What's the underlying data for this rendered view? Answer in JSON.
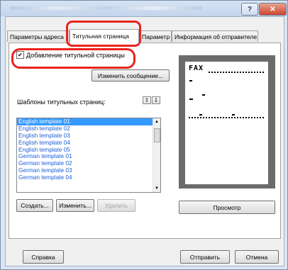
{
  "window": {
    "help_button": "?",
    "close_button": "✕"
  },
  "tabs": [
    {
      "label": "Параметры адреса"
    },
    {
      "label": "Титульная страница"
    },
    {
      "label": "Параметр"
    },
    {
      "label": "Информация об отправителе"
    }
  ],
  "cover_page": {
    "checkbox_label": "Добавление титульной страницы",
    "checkbox_checked": true,
    "edit_message_button": "Изменить сообщение...",
    "templates_label": "Шаблоны титульных страниц:",
    "up_arrow": "⇧",
    "down_arrow": "⇩",
    "templates": [
      "English template 01",
      "English template 02",
      "English template 03",
      "English template 04",
      "English template 05",
      "German template 01",
      "German template 02",
      "German template 03",
      "German template 04"
    ],
    "selected_template": "English template 01",
    "create_button": "Создать...",
    "modify_button": "Изменить...",
    "delete_button": "Удалить",
    "preview_button": "Просмотр",
    "preview_heading": "FAX"
  },
  "footer": {
    "help_button": "Справка",
    "send_button": "Отправить",
    "cancel_button": "Отмена"
  },
  "highlight_color": "#e8231f"
}
